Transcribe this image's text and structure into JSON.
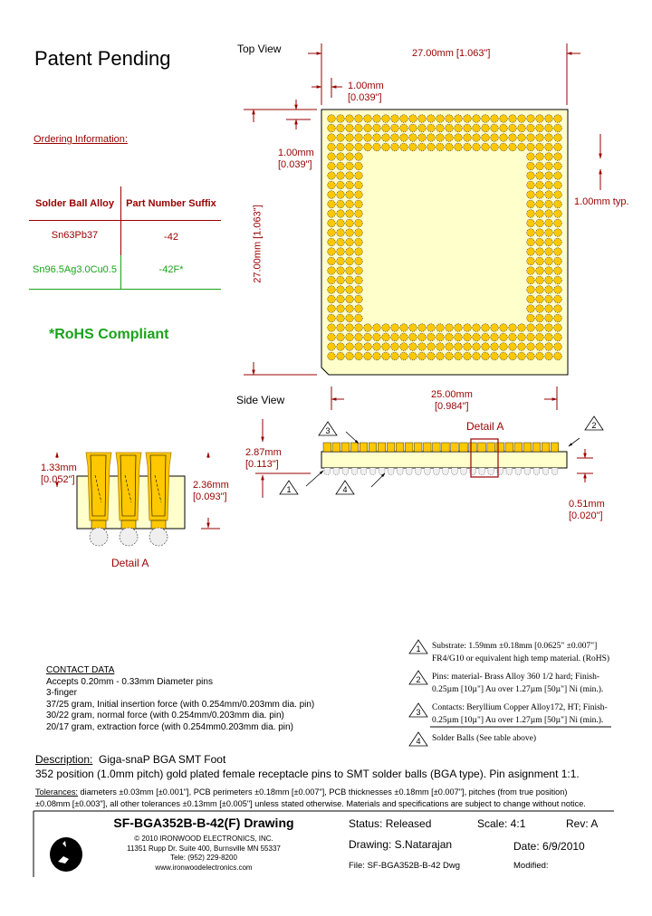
{
  "header": {
    "title": "Patent Pending",
    "ordering_heading": "Ordering Information:"
  },
  "ordering_table": {
    "columns": [
      "Solder Ball Alloy",
      "Part Number Suffix"
    ],
    "rows": [
      {
        "alloy": "Sn63Pb37",
        "suffix": "-42",
        "color": "#990000"
      },
      {
        "alloy": "Sn96.5Ag3.0Cu0.5",
        "suffix": "-42F*",
        "color": "#1aa31a"
      }
    ],
    "rohs_note": "*RoHS Compliant"
  },
  "top_view": {
    "label": "Top View",
    "width_mm": "27.00mm  [1.063\"]",
    "height_mm": "27.00mm  [1.063\"]",
    "edge_offset_x": "1.00mm",
    "edge_offset_x_in": "[0.039\"]",
    "edge_offset_y": "1.00mm",
    "edge_offset_y_in": "[0.039\"]",
    "pitch": "1.00mm typ.",
    "grid": {
      "count": 26,
      "ring_depth": 4
    }
  },
  "side_view": {
    "label": "Side View",
    "span_mm": "25.00mm",
    "span_in": "[0.984\"]",
    "height_mm": "2.87mm",
    "height_in": "[0.113\"]",
    "ball_mm": "0.51mm",
    "ball_in": "[0.020\"]",
    "detail_label": "Detail A",
    "callouts": [
      "1",
      "2",
      "3",
      "4"
    ]
  },
  "detail_a": {
    "label": "Detail A",
    "left_dim_mm": "1.33mm",
    "left_dim_in": "[0.052\"]",
    "right_dim_mm": "2.36mm",
    "right_dim_in": "[0.093\"]"
  },
  "notes": [
    {
      "num": "1",
      "line1": "Substrate: 1.59mm ±0.18mm [0.0625\" ±0.007\"]",
      "line2": "FR4/G10 or equivalent high temp material. (RoHS)"
    },
    {
      "num": "2",
      "line1": "Pins: material- Brass Alloy 360 1/2 hard; Finish-",
      "line2": "0.25µm [10µ\"] Au over 1.27µm [50µ\"] Ni (min.)."
    },
    {
      "num": "3",
      "line1": "Contacts: Beryllium Copper Alloy172, HT; Finish-",
      "line2": "0.25µm [10µ\"] Au over 1.27µm [50µ\"] Ni (min.)."
    },
    {
      "num": "4",
      "line1": "Solder Balls (See table above)",
      "line2": ""
    }
  ],
  "contact_data": {
    "heading": "CONTACT DATA",
    "lines": [
      "Accepts 0.20mm - 0.33mm Diameter pins",
      "3-finger",
      "37/25 gram, Initial insertion force (with 0.254mm/0.203mm dia. pin)",
      "30/22 gram, normal force (with 0.254mm/0.203mm dia. pin)",
      "20/17 gram, extraction force (with 0.254mm0.203mm dia. pin)"
    ]
  },
  "description": {
    "label": "Description:",
    "title": "Giga-snaP BGA SMT Foot",
    "text": "352 position (1.0mm pitch) gold plated female receptacle pins to SMT solder balls (BGA type). Pin asignment 1:1."
  },
  "tolerances": {
    "label": "Tolerances:",
    "line1": " diameters ±0.03mm [±0.001\"], PCB perimeters ±0.18mm [±0.007\"], PCB thicknesses ±0.18mm [±0.007\"], pitches (from true position)",
    "line2": "±0.08mm [±0.003\"], all other tolerances ±0.13mm [±0.005\"] unless stated otherwise.  Materials and specifications are subject to change without notice."
  },
  "title_block": {
    "drawing_title": "SF-BGA352B-B-42(F) Drawing",
    "company_lines": [
      "© 2010  IRONWOOD ELECTRONICS, INC.",
      "11351 Rupp Dr. Suite 400, Burnsville MN 55337",
      "Tele: (952) 229-8200",
      "www.ironwoodelectronics.com"
    ],
    "status": "Status: Released",
    "scale": "Scale: 4:1",
    "rev": "Rev: A",
    "drawn_by": "Drawing: S.Natarajan",
    "date": "Date: 6/9/2010",
    "file": "File: SF-BGA352B-B-42 Dwg",
    "modified": "Modified:"
  },
  "colors": {
    "dimension": "#990000",
    "gold": "#ffc800",
    "substrate": "#ffffcc",
    "rohs": "#1aa31a"
  }
}
